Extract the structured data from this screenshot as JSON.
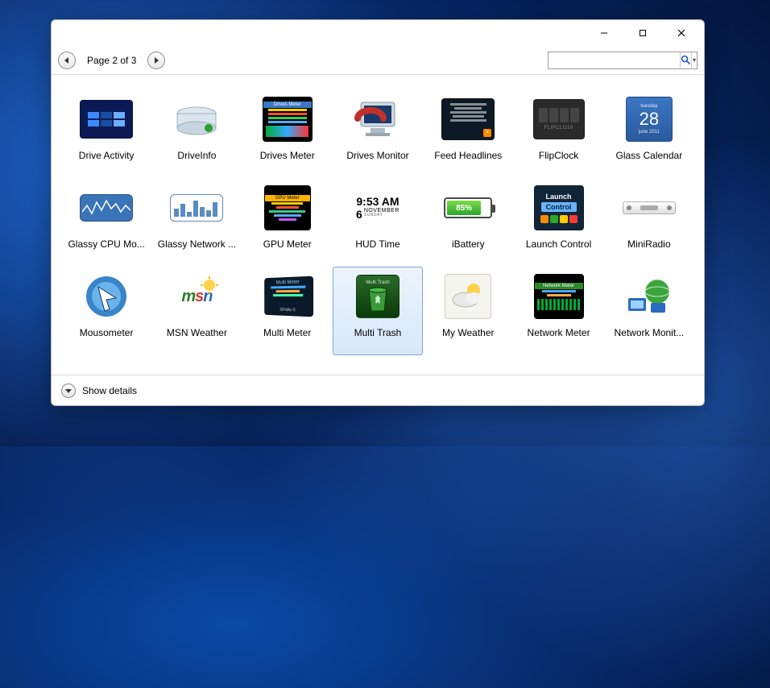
{
  "toolbar": {
    "page_indicator": "Page 2 of 3",
    "search_placeholder": ""
  },
  "footer": {
    "show_details": "Show details"
  },
  "gadgets": [
    {
      "label": "Drive Activity",
      "icon": "drive-activity",
      "selected": false
    },
    {
      "label": "DriveInfo",
      "icon": "driveinfo",
      "selected": false
    },
    {
      "label": "Drives Meter",
      "icon": "drives-meter",
      "selected": false
    },
    {
      "label": "Drives Monitor",
      "icon": "drives-monitor",
      "selected": false
    },
    {
      "label": "Feed Headlines",
      "icon": "feed-headlines",
      "selected": false
    },
    {
      "label": "FlipClock",
      "icon": "flipclock",
      "selected": false
    },
    {
      "label": "Glass Calendar",
      "icon": "glass-calendar",
      "selected": false
    },
    {
      "label": "Glassy CPU Mo...",
      "icon": "glassy-cpu",
      "selected": false
    },
    {
      "label": "Glassy Network ...",
      "icon": "glassy-network",
      "selected": false
    },
    {
      "label": "GPU Meter",
      "icon": "gpu-meter",
      "selected": false
    },
    {
      "label": "HUD Time",
      "icon": "hud-time",
      "selected": false
    },
    {
      "label": "iBattery",
      "icon": "ibattery",
      "selected": false
    },
    {
      "label": "Launch Control",
      "icon": "launch-control",
      "selected": false
    },
    {
      "label": "MiniRadio",
      "icon": "miniradio",
      "selected": false
    },
    {
      "label": "Mousometer",
      "icon": "mousometer",
      "selected": false
    },
    {
      "label": "MSN Weather",
      "icon": "msn-weather",
      "selected": false
    },
    {
      "label": "Multi Meter",
      "icon": "multi-meter",
      "selected": false
    },
    {
      "label": "Multi Trash",
      "icon": "multi-trash",
      "selected": true
    },
    {
      "label": "My Weather",
      "icon": "my-weather",
      "selected": false
    },
    {
      "label": "Network Meter",
      "icon": "network-meter",
      "selected": false
    },
    {
      "label": "Network Monit...",
      "icon": "network-monitor",
      "selected": false
    }
  ],
  "preview_text": {
    "hud_time_line1": "9:53 AM",
    "hud_time_line2": "6 ",
    "hud_time_line3": "NOVEMBER",
    "hud_time_line4": "SUNDAY",
    "ibattery_pct": "85%",
    "launch_line1": "Launch",
    "launch_line2": "Control",
    "calendar_day": "28",
    "calendar_month": "june 2011",
    "calendar_weekday": "tuesday",
    "drives_meter_title": "Drives Meter",
    "gpu_meter_title": "GPU Meter",
    "network_meter_title": "Network Meter",
    "multi_trash_title": "Multi Trash",
    "multi_meter_title": "Multi Meter",
    "multi_meter_sub": "SFkilla ©",
    "msn_text": "msn",
    "flipclock_text": "FLIPCLO10"
  }
}
